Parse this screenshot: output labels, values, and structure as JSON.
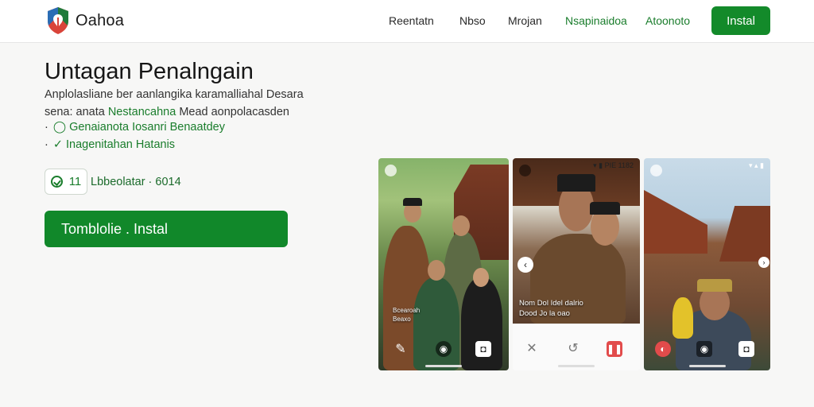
{
  "header": {
    "brand": "Oahoa",
    "nav": [
      {
        "label": "Reentatn",
        "accent": false
      },
      {
        "label": "Nbso",
        "accent": false
      },
      {
        "label": "Mrojan",
        "accent": false
      },
      {
        "label": "Nsapinaidoa",
        "accent": true
      },
      {
        "label": "Atoonoto",
        "accent": true
      }
    ],
    "install_label": "Instal"
  },
  "hero": {
    "title": "Untagan Penalngain",
    "desc_line1": "Anplolasliane ber aanlangika karamalliahal Desara",
    "desc_line2_pre": "sena: anata",
    "desc_line2_highlight": "Nestancahna",
    "desc_line2_post": "Mead aonpolacasden",
    "features": [
      {
        "bullet": "·",
        "icon": "◯",
        "text": "Genaianota Iosanri Benaatdey"
      },
      {
        "bullet": "·",
        "icon": "✓",
        "text": "Inagenitahan Hatanis"
      }
    ],
    "rating": {
      "value": "11",
      "text": "Lbbeolatar · 6014"
    },
    "cta_label": "Tomblolie . Instal"
  },
  "screens": {
    "s1": {
      "status": "",
      "caption_line1": "Bcearoah",
      "caption_line2": "Beaxo"
    },
    "s2": {
      "status": "▾ ▮ PIE  1182",
      "caption_line1": "Nom Dol Idel dalrio",
      "caption_line2": "Dood Jo la oao"
    },
    "s3": {
      "status": "▾ ▴ ▮"
    }
  },
  "colors": {
    "accent": "#138a2a",
    "accent_text": "#1a7d2c",
    "header_bg": "#ffffff",
    "page_bg": "#f7f7f6"
  }
}
